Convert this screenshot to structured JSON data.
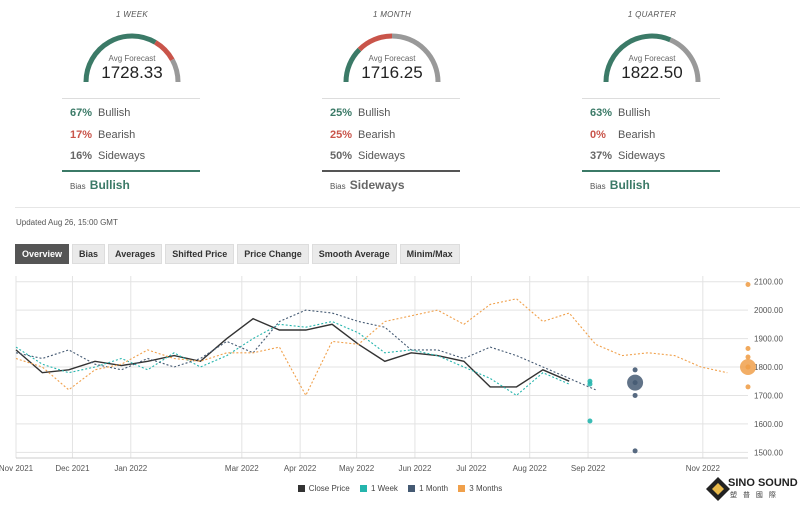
{
  "colors": {
    "bullish": "#3b7a67",
    "bearish": "#c9544a",
    "sideways": "#999999",
    "close": "#333333",
    "week": "#25b5ad",
    "month": "#455a73",
    "quarter": "#f0a04b"
  },
  "panels": [
    {
      "period": "1 WEEK",
      "avg_label": "Avg Forecast",
      "avg_value": "1728.33",
      "bullish_pct": "67%",
      "bullish_label": "Bullish",
      "bearish_pct": "17%",
      "bearish_label": "Bearish",
      "sideways_pct": "16%",
      "sideways_label": "Sideways",
      "bias_label": "Bias",
      "bias_value": "Bullish",
      "gauge": {
        "bullish": 0.67,
        "bearish": 0.17,
        "sideways": 0.16
      }
    },
    {
      "period": "1 MONTH",
      "avg_label": "Avg Forecast",
      "avg_value": "1716.25",
      "bullish_pct": "25%",
      "bullish_label": "Bullish",
      "bearish_pct": "25%",
      "bearish_label": "Bearish",
      "sideways_pct": "50%",
      "sideways_label": "Sideways",
      "bias_label": "Bias",
      "bias_value": "Sideways",
      "gauge": {
        "bullish": 0.25,
        "bearish": 0.25,
        "sideways": 0.5
      }
    },
    {
      "period": "1 QUARTER",
      "avg_label": "Avg Forecast",
      "avg_value": "1822.50",
      "bullish_pct": "63%",
      "bullish_label": "Bullish",
      "bearish_pct": "0%",
      "bearish_label": "Bearish",
      "sideways_pct": "37%",
      "sideways_label": "Sideways",
      "bias_label": "Bias",
      "bias_value": "Bullish",
      "gauge": {
        "bullish": 0.63,
        "bearish": 0.0,
        "sideways": 0.37
      }
    }
  ],
  "updated": "Updated Aug 26, 15:00 GMT",
  "tabs": [
    "Overview",
    "Bias",
    "Averages",
    "Shifted Price",
    "Price Change",
    "Smooth Average",
    "Minim/Max"
  ],
  "active_tab": "Overview",
  "logo": {
    "text": "SINO SOUND",
    "sub": "塑 普 國 際"
  },
  "chart_data": {
    "type": "line",
    "x_ticks": [
      "Nov 2021",
      "Dec 2021",
      "Jan 2022",
      "Mar 2022",
      "Apr 2022",
      "May 2022",
      "Jun 2022",
      "Jul 2022",
      "Aug 2022",
      "Sep 2022",
      "Nov 2022"
    ],
    "y_ticks": [
      "1500.00",
      "1600.00",
      "1700.00",
      "1800.00",
      "1900.00",
      "2000.00",
      "2100.00"
    ],
    "ylim": [
      1480,
      2120
    ],
    "x_range": [
      "2021-11-01",
      "2022-11-25"
    ],
    "legend": [
      "Close Price",
      "1 Week",
      "1 Month",
      "3 Months"
    ],
    "series": [
      {
        "name": "Close Price",
        "style": "solid",
        "points": [
          [
            "2021-11-01",
            1860
          ],
          [
            "2021-11-15",
            1780
          ],
          [
            "2021-11-29",
            1790
          ],
          [
            "2021-12-13",
            1820
          ],
          [
            "2021-12-27",
            1805
          ],
          [
            "2022-01-10",
            1820
          ],
          [
            "2022-01-24",
            1840
          ],
          [
            "2022-02-07",
            1820
          ],
          [
            "2022-02-21",
            1900
          ],
          [
            "2022-03-07",
            1970
          ],
          [
            "2022-03-21",
            1930
          ],
          [
            "2022-04-04",
            1930
          ],
          [
            "2022-04-18",
            1950
          ],
          [
            "2022-05-02",
            1880
          ],
          [
            "2022-05-16",
            1820
          ],
          [
            "2022-05-30",
            1850
          ],
          [
            "2022-06-13",
            1840
          ],
          [
            "2022-06-27",
            1820
          ],
          [
            "2022-07-11",
            1730
          ],
          [
            "2022-07-25",
            1730
          ],
          [
            "2022-08-08",
            1790
          ],
          [
            "2022-08-22",
            1750
          ]
        ]
      },
      {
        "name": "1 Week",
        "style": "dashed",
        "points": [
          [
            "2021-11-01",
            1870
          ],
          [
            "2021-11-15",
            1810
          ],
          [
            "2021-11-29",
            1780
          ],
          [
            "2021-12-13",
            1800
          ],
          [
            "2021-12-27",
            1830
          ],
          [
            "2022-01-10",
            1790
          ],
          [
            "2022-01-24",
            1850
          ],
          [
            "2022-02-07",
            1800
          ],
          [
            "2022-02-21",
            1840
          ],
          [
            "2022-03-07",
            1900
          ],
          [
            "2022-03-21",
            1950
          ],
          [
            "2022-04-04",
            1940
          ],
          [
            "2022-04-18",
            1960
          ],
          [
            "2022-05-02",
            1920
          ],
          [
            "2022-05-16",
            1850
          ],
          [
            "2022-05-30",
            1860
          ],
          [
            "2022-06-13",
            1840
          ],
          [
            "2022-06-27",
            1800
          ],
          [
            "2022-07-11",
            1760
          ],
          [
            "2022-07-25",
            1700
          ],
          [
            "2022-08-08",
            1780
          ],
          [
            "2022-08-22",
            1740
          ]
        ]
      },
      {
        "name": "1 Month",
        "style": "dashed",
        "points": [
          [
            "2021-11-01",
            1850
          ],
          [
            "2021-11-15",
            1830
          ],
          [
            "2021-11-29",
            1860
          ],
          [
            "2021-12-13",
            1810
          ],
          [
            "2021-12-27",
            1790
          ],
          [
            "2022-01-10",
            1830
          ],
          [
            "2022-01-24",
            1800
          ],
          [
            "2022-02-07",
            1830
          ],
          [
            "2022-02-21",
            1890
          ],
          [
            "2022-03-07",
            1850
          ],
          [
            "2022-03-21",
            1960
          ],
          [
            "2022-04-04",
            2000
          ],
          [
            "2022-04-18",
            1990
          ],
          [
            "2022-05-02",
            1960
          ],
          [
            "2022-05-16",
            1940
          ],
          [
            "2022-05-30",
            1860
          ],
          [
            "2022-06-13",
            1860
          ],
          [
            "2022-06-27",
            1830
          ],
          [
            "2022-07-11",
            1870
          ],
          [
            "2022-07-25",
            1840
          ],
          [
            "2022-08-08",
            1800
          ],
          [
            "2022-08-22",
            1760
          ],
          [
            "2022-09-05",
            1720
          ]
        ]
      },
      {
        "name": "3 Months",
        "style": "dashed",
        "points": [
          [
            "2021-11-01",
            1830
          ],
          [
            "2021-11-15",
            1800
          ],
          [
            "2021-11-29",
            1720
          ],
          [
            "2021-12-13",
            1790
          ],
          [
            "2021-12-27",
            1810
          ],
          [
            "2022-01-10",
            1860
          ],
          [
            "2022-01-24",
            1830
          ],
          [
            "2022-02-07",
            1820
          ],
          [
            "2022-02-21",
            1850
          ],
          [
            "2022-03-07",
            1850
          ],
          [
            "2022-03-21",
            1870
          ],
          [
            "2022-04-04",
            1700
          ],
          [
            "2022-04-18",
            1890
          ],
          [
            "2022-05-02",
            1880
          ],
          [
            "2022-05-16",
            1960
          ],
          [
            "2022-05-30",
            1980
          ],
          [
            "2022-06-13",
            2000
          ],
          [
            "2022-06-27",
            1950
          ],
          [
            "2022-07-11",
            2020
          ],
          [
            "2022-07-25",
            2040
          ],
          [
            "2022-08-08",
            1960
          ],
          [
            "2022-08-22",
            1990
          ],
          [
            "2022-09-05",
            1880
          ],
          [
            "2022-09-19",
            1840
          ],
          [
            "2022-10-03",
            1850
          ],
          [
            "2022-10-17",
            1840
          ],
          [
            "2022-10-31",
            1800
          ],
          [
            "2022-11-14",
            1780
          ]
        ]
      }
    ],
    "forecast_markers": [
      {
        "series": "1 Week",
        "date": "2022-09-02",
        "values": [
          1750,
          1740,
          1610
        ]
      },
      {
        "series": "1 Month",
        "date": "2022-09-26",
        "values": [
          1790,
          1745,
          1700,
          1505
        ],
        "big": 1745
      },
      {
        "series": "3 Months",
        "date": "2022-11-25",
        "values": [
          2090,
          1865,
          1835,
          1800,
          1800,
          1730
        ],
        "big": 1800
      }
    ]
  }
}
